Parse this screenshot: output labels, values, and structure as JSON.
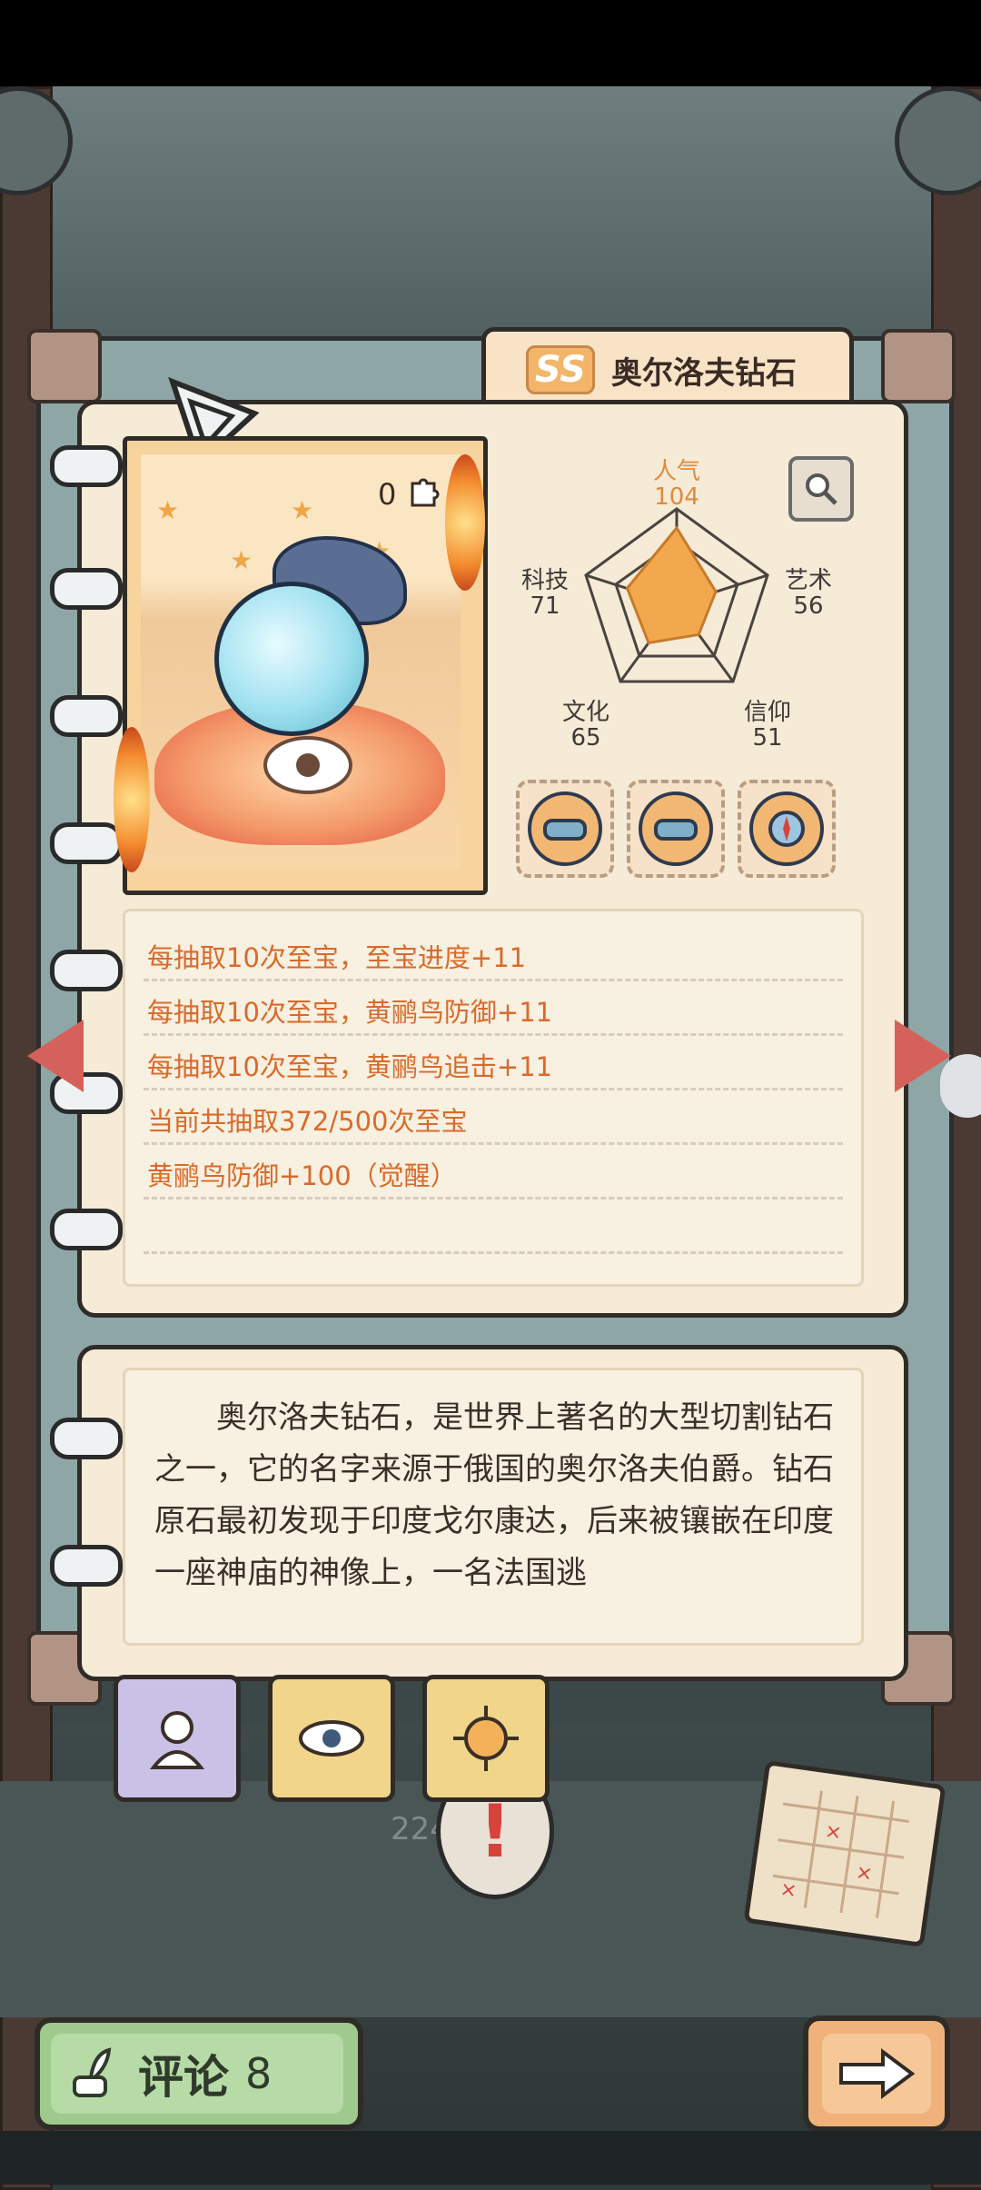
{
  "item": {
    "rarity": "SS",
    "name": "奥尔洛夫钻石",
    "count": "0"
  },
  "stats": {
    "popularity": {
      "label": "人气",
      "value": 104
    },
    "art": {
      "label": "艺术",
      "value": 56
    },
    "belief": {
      "label": "信仰",
      "value": 51
    },
    "culture": {
      "label": "文化",
      "value": 65
    },
    "tech": {
      "label": "科技",
      "value": 71
    }
  },
  "effects": [
    "每抽取10次至宝，至宝进度+11",
    "每抽取10次至宝，黄鹂鸟防御+11",
    "每抽取10次至宝，黄鹂鸟追击+11",
    "当前共抽取372/500次至宝",
    "黄鹂鸟防御+100（觉醒）"
  ],
  "description": "奥尔洛夫钻石，是世界上著名的大型切割钻石之一，它的名字来源于俄国的奥尔洛夫伯爵。钻石原石最初发现于印度戈尔康达，后来被镶嵌在印度一座神庙的神像上，一名法国逃",
  "background_count": "224件",
  "comment": {
    "label": "评论",
    "count": "8"
  },
  "colors": {
    "effect_text": "#d96a2b",
    "radar_fill": "#f2a94e",
    "card_bg": "#f5ebd7"
  }
}
